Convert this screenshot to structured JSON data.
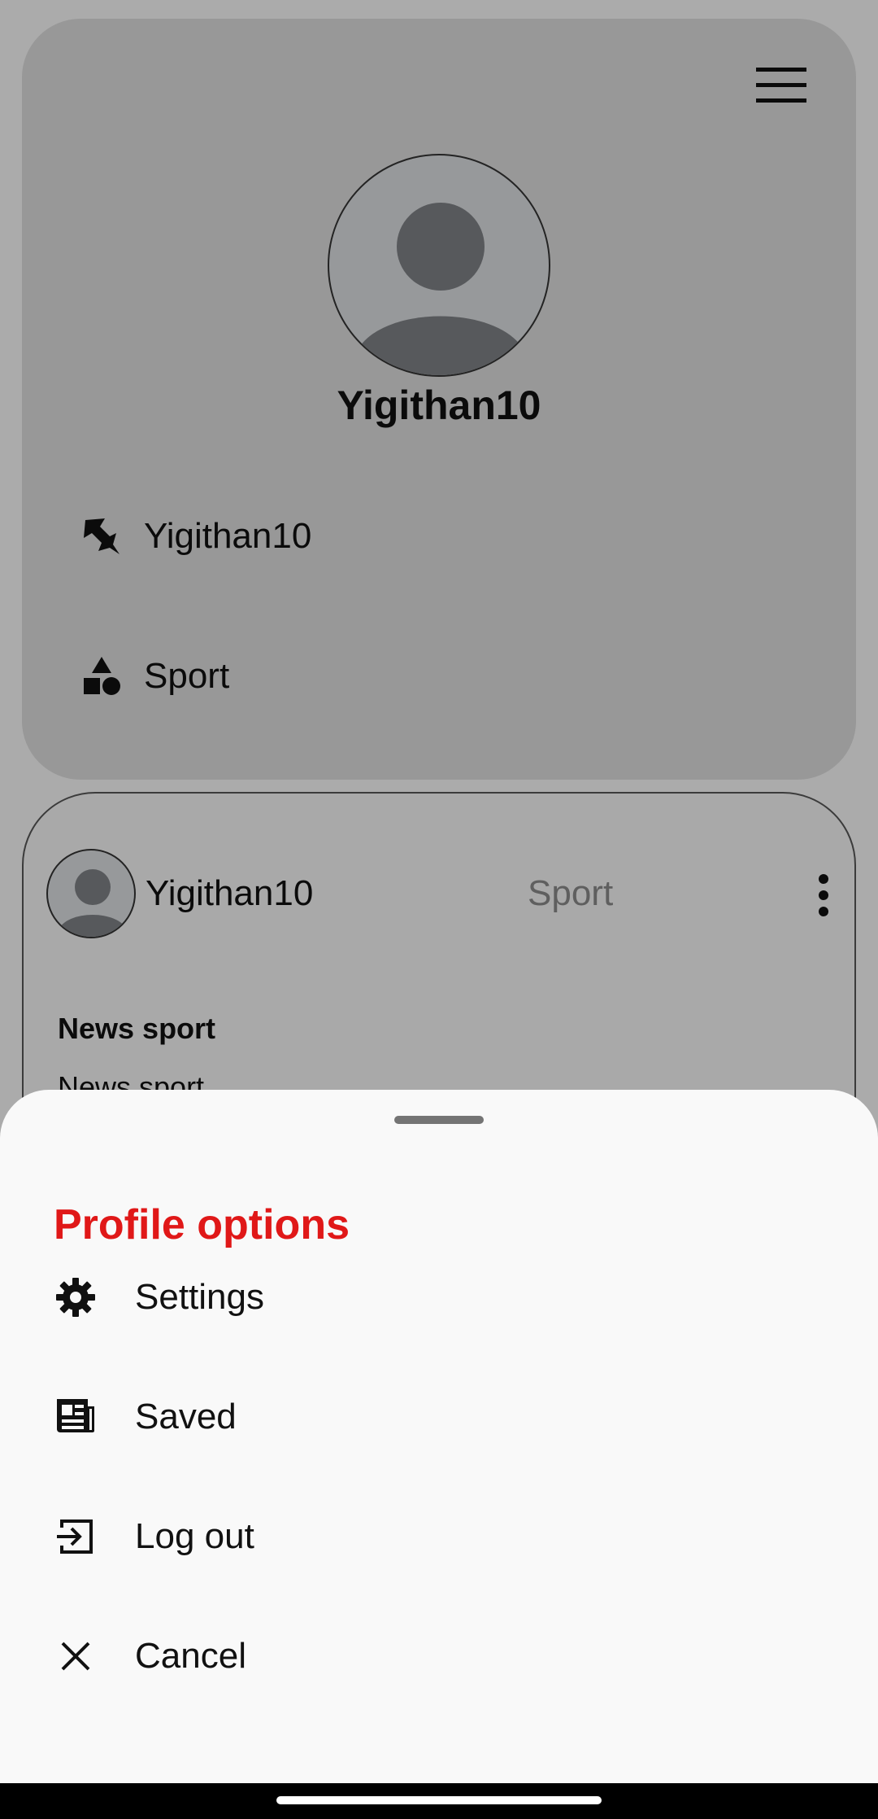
{
  "profile": {
    "username": "Yigithan10",
    "pinned_label": "Yigithan10",
    "category_label": "Sport",
    "menu_icon": "hamburger-menu-icon",
    "avatar_icon": "person-placeholder-icon"
  },
  "post": {
    "author": "Yigithan10",
    "category": "Sport",
    "title": "News sport",
    "body": "News sport"
  },
  "sheet": {
    "title": "Profile options",
    "title_color": "#e01818",
    "items": [
      {
        "label": "Settings",
        "icon": "gear-icon"
      },
      {
        "label": "Saved",
        "icon": "newspaper-icon"
      },
      {
        "label": "Log out",
        "icon": "logout-icon"
      },
      {
        "label": "Cancel",
        "icon": "close-icon"
      }
    ]
  }
}
